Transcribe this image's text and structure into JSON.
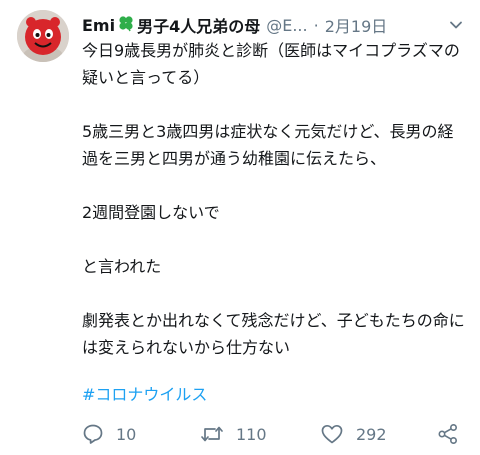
{
  "tweet": {
    "display_name": "Emi",
    "name_suffix": "男子4人兄弟の母",
    "handle": "@E...",
    "separator": "·",
    "time": "2月19日",
    "paragraphs": [
      "今日9歳長男が肺炎と診断（医師はマイコプラズマの疑いと言ってる）",
      "5歳三男と3歳四男は症状なく元気だけど、長男の経過を三男と四男が通う幼稚園に伝えたら、",
      "2週間登園しないで",
      "と言われた",
      "劇発表とか出れなくて残念だけど、子どもたちの命には変えられないから仕方ない"
    ],
    "hashtag": "#コロナウイルス"
  },
  "actions": {
    "reply_count": "10",
    "retweet_count": "110",
    "like_count": "292"
  },
  "icons": {
    "avatar": "red-mascot-avatar",
    "name_emoji": "four-leaf-clover-icon",
    "caret": "chevron-down-icon",
    "reply": "reply-icon",
    "retweet": "retweet-icon",
    "like": "heart-icon",
    "share": "share-icon"
  },
  "colors": {
    "text": "#14171a",
    "muted": "#657786",
    "link": "#1da1f2",
    "clover": "#2fae4a",
    "avatar_red": "#d8262b"
  }
}
